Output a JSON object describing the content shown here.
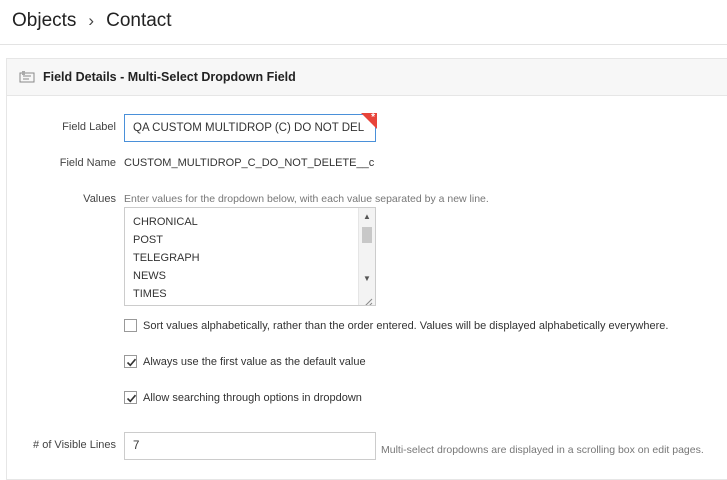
{
  "breadcrumb": {
    "root": "Objects",
    "separator": "›",
    "current": "Contact"
  },
  "panel": {
    "title": "Field Details - Multi-Select Dropdown Field",
    "icon": "field-icon"
  },
  "form": {
    "field_label": {
      "label": "Field Label",
      "value": "QA CUSTOM MULTIDROP (C) DO NOT DEL",
      "required_mark": "*"
    },
    "field_name": {
      "label": "Field Name",
      "value": "CUSTOM_MULTIDROP_C_DO_NOT_DELETE__c"
    },
    "values": {
      "label": "Values",
      "hint": "Enter values for the dropdown below, with each value separated by a new line.",
      "items": [
        "CHRONICAL",
        "POST",
        "TELEGRAPH",
        "NEWS",
        "TIMES"
      ]
    },
    "options": [
      {
        "label": "Sort values alphabetically, rather than the order entered. Values will be displayed alphabetically everywhere.",
        "checked": false
      },
      {
        "label": "Always use the first value as the default value",
        "checked": true
      },
      {
        "label": "Allow searching through options in dropdown",
        "checked": true
      }
    ],
    "visible_lines": {
      "label": "# of Visible Lines",
      "value": "7",
      "hint": "Multi-select dropdowns are displayed in a scrolling box on edit pages."
    }
  }
}
